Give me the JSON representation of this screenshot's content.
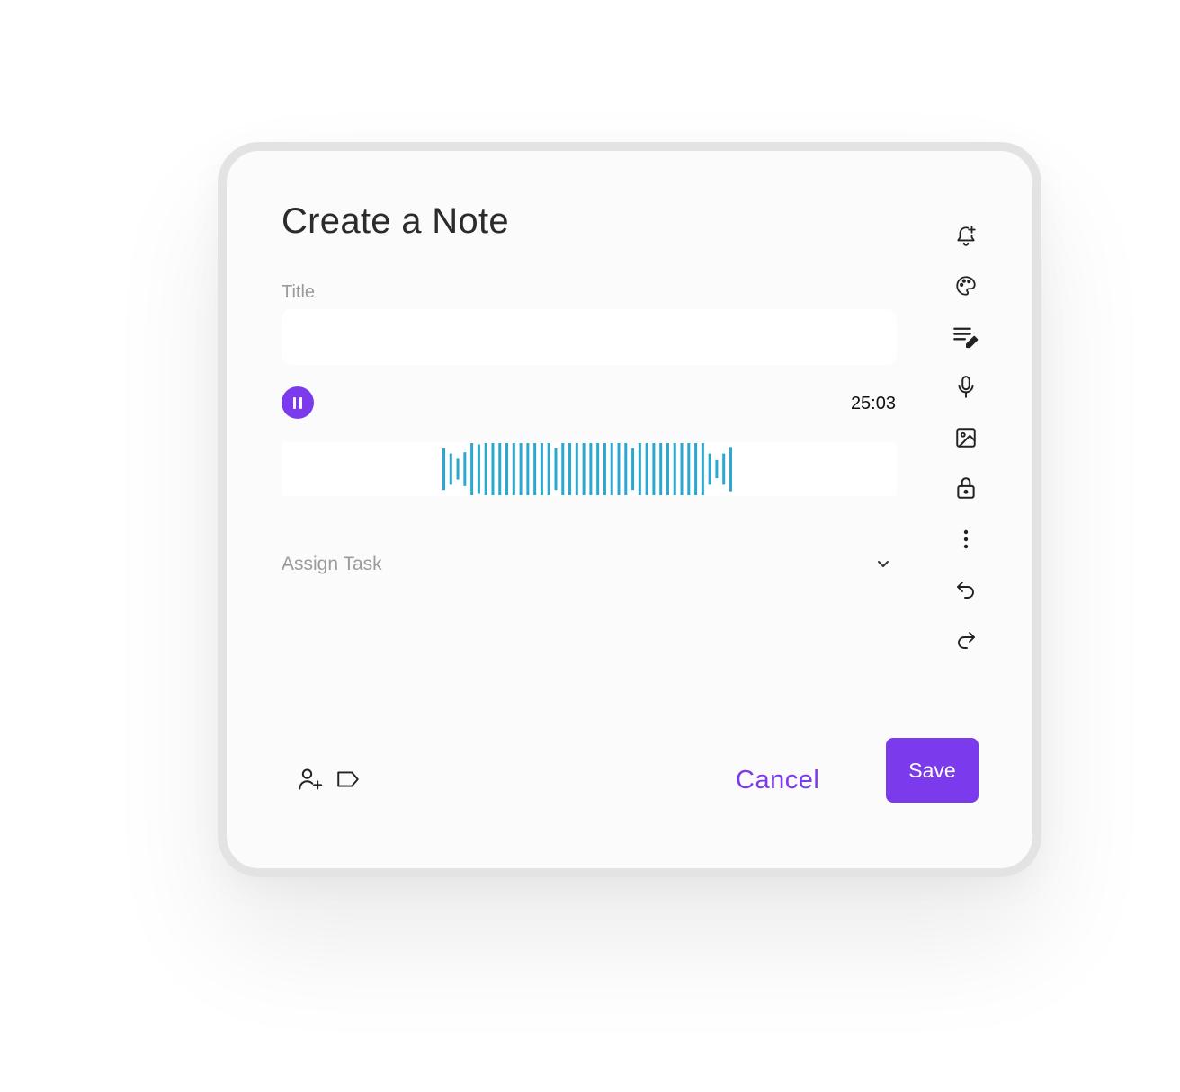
{
  "dialog": {
    "heading": "Create a Note",
    "title_label": "Title",
    "title_value": "",
    "title_placeholder": "",
    "timer": "25:03",
    "assign_label": "Assign Task",
    "cancel_label": "Cancel",
    "save_label": "Save"
  },
  "recorder": {
    "state": "recording",
    "waveform_levels": [
      0.8,
      0.6,
      0.4,
      0.65,
      1,
      0.95,
      1,
      1,
      1,
      1,
      1,
      1,
      1,
      1,
      1,
      1,
      0.8,
      1,
      1,
      1,
      1,
      1,
      1,
      1,
      1,
      1,
      1,
      0.8,
      1,
      1,
      1,
      1,
      1,
      1,
      1,
      1,
      1,
      1,
      0.6,
      0.35,
      0.6,
      0.85
    ]
  },
  "toolbar": {
    "icons": [
      "bell-plus-icon",
      "palette-icon",
      "edit-text-icon",
      "microphone-icon",
      "image-icon",
      "lock-icon",
      "more-vertical-icon",
      "undo-icon",
      "redo-icon"
    ]
  },
  "footer": {
    "icons": [
      "add-user-icon",
      "tag-icon"
    ]
  },
  "colors": {
    "accent": "#7c3aed",
    "waveform": "#2aa8d0",
    "card_border": "#e3e3e3",
    "card_bg": "#fbfbfb"
  }
}
